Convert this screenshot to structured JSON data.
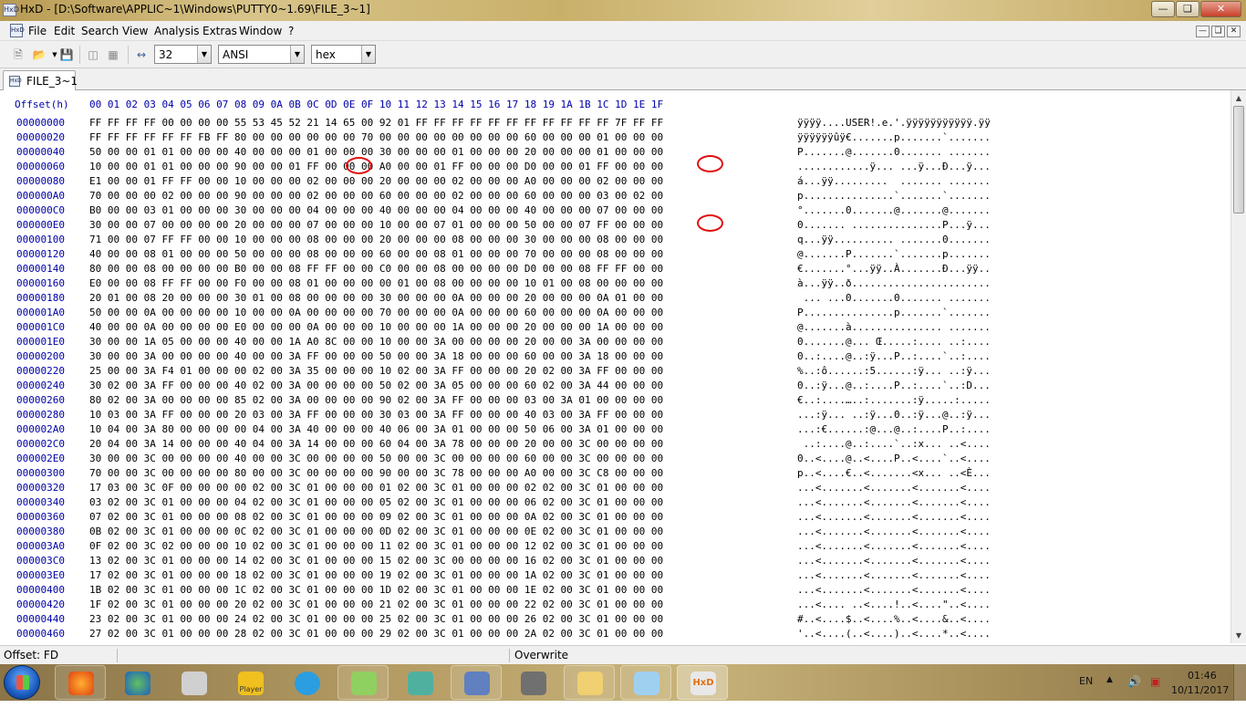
{
  "window": {
    "title": "HxD - [D:\\Software\\APPLIC~1\\Windows\\PUTTY0~1.69\\FILE_3~1]",
    "app_icon_text": "HxD"
  },
  "menu": [
    "File",
    "Edit",
    "Search",
    "View",
    "Analysis",
    "Extras",
    "Window",
    "?"
  ],
  "toolbar": {
    "bytes_per_row": "32",
    "charset": "ANSI",
    "offset_base": "hex"
  },
  "tab": {
    "label": "FILE_3~1"
  },
  "header": {
    "offset_label": "Offset(h)",
    "columns": [
      "00",
      "01",
      "02",
      "03",
      "04",
      "05",
      "06",
      "07",
      "08",
      "09",
      "0A",
      "0B",
      "0C",
      "0D",
      "0E",
      "0F",
      "10",
      "11",
      "12",
      "13",
      "14",
      "15",
      "16",
      "17",
      "18",
      "19",
      "1A",
      "1B",
      "1C",
      "1D",
      "1E",
      "1F"
    ]
  },
  "rows": [
    {
      "offset": "00000000",
      "hex": "FF FF FF FF 00 00 00 00 55 53 45 52 21 14 65 00 92 01 FF FF FF FF FF FF FF FF FF FF FF 7F FF FF",
      "ascii": "ÿÿÿÿ....USER!.e.'.ÿÿÿÿÿÿÿÿÿÿÿ.ÿÿ"
    },
    {
      "offset": "00000020",
      "hex": "FF FF FF FF FF FF FB FF 80 00 00 00 00 00 00 70 00 00 00 00 00 00 00 00 60 00 00 00 01 00 00 00",
      "ascii": "ÿÿÿÿÿÿûÿ€.......p.......`......."
    },
    {
      "offset": "00000040",
      "hex": "50 00 00 01 01 00 00 00 40 00 00 00 01 00 00 00 30 00 00 00 01 00 00 00 20 00 00 00 01 00 00 00",
      "ascii": "P.......@.......0....... ......."
    },
    {
      "offset": "00000060",
      "hex": "10 00 00 01 01 00 00 00 90 00 00 01 FF 00 00 00 A0 00 00 01 FF 00 00 00 D0 00 00 01 FF 00 00 00",
      "ascii": "............ÿ... ...ÿ...Ð...ÿ..."
    },
    {
      "offset": "00000080",
      "hex": "E1 00 00 01 FF FF 00 00 10 00 00 00 02 00 00 00 20 00 00 00 02 00 00 00 A0 00 00 00 02 00 00 00",
      "ascii": "á...ÿÿ.........  ....... ......."
    },
    {
      "offset": "000000A0",
      "hex": "70 00 00 00 02 00 00 00 90 00 00 00 02 00 00 00 60 00 00 00 02 00 00 00 60 00 00 00 03 00 02 00",
      "ascii": "p...............`.......`......."
    },
    {
      "offset": "000000C0",
      "hex": "B0 00 00 03 01 00 00 00 30 00 00 00 04 00 00 00 40 00 00 00 04 00 00 00 40 00 00 00 07 00 00 00",
      "ascii": "°.......0.......@.......@......."
    },
    {
      "offset": "000000E0",
      "hex": "30 00 00 07 00 00 00 00 20 00 00 00 07 00 00 00 10 00 00 07 01 00 00 00 50 00 00 07 FF 00 00 00",
      "ascii": "0....... ...............P...ÿ..."
    },
    {
      "offset": "00000100",
      "hex": "71 00 00 07 FF FF 00 00 10 00 00 00 08 00 00 00 20 00 00 00 08 00 00 00 30 00 00 00 08 00 00 00",
      "ascii": "q...ÿÿ.......... .......0......."
    },
    {
      "offset": "00000120",
      "hex": "40 00 00 08 01 00 00 00 50 00 00 00 08 00 00 00 60 00 00 08 01 00 00 00 70 00 00 00 08 00 00 00",
      "ascii": "@.......P.......`.......p......."
    },
    {
      "offset": "00000140",
      "hex": "80 00 00 08 00 00 00 00 B0 00 00 08 FF FF 00 00 C0 00 00 08 00 00 00 00 D0 00 00 08 FF FF 00 00",
      "ascii": "€.......°...ÿÿ..À.......Ð...ÿÿ.."
    },
    {
      "offset": "00000160",
      "hex": "E0 00 00 08 FF FF 00 00 F0 00 00 08 01 00 00 00 00 01 00 08 00 00 00 00 10 01 00 08 00 00 00 00",
      "ascii": "à...ÿÿ..ð......................."
    },
    {
      "offset": "00000180",
      "hex": "20 01 00 08 20 00 00 00 30 01 00 08 00 00 00 00 30 00 00 00 0A 00 00 00 20 00 00 00 0A 01 00 00",
      "ascii": " ... ...0.......0....... ......."
    },
    {
      "offset": "000001A0",
      "hex": "50 00 00 0A 00 00 00 00 10 00 00 0A 00 00 00 00 70 00 00 00 0A 00 00 00 60 00 00 00 0A 00 00 00",
      "ascii": "P...............p.......`......."
    },
    {
      "offset": "000001C0",
      "hex": "40 00 00 0A 00 00 00 00 E0 00 00 00 0A 00 00 00 10 00 00 00 1A 00 00 00 20 00 00 00 1A 00 00 00",
      "ascii": "@.......à............... ......."
    },
    {
      "offset": "000001E0",
      "hex": "30 00 00 1A 05 00 00 00 40 00 00 1A A0 8C 00 00 10 00 00 3A 00 00 00 00 20 00 00 3A 00 00 00 00",
      "ascii": "0.......@... Œ.....:.... ..:...."
    },
    {
      "offset": "00000200",
      "hex": "30 00 00 3A 00 00 00 00 40 00 00 3A FF 00 00 00 50 00 00 3A 18 00 00 00 60 00 00 3A 18 00 00 00",
      "ascii": "0..:....@..:ÿ...P..:....`..:...."
    },
    {
      "offset": "00000220",
      "hex": "25 00 00 3A F4 01 00 00 00 02 00 3A 35 00 00 00 10 02 00 3A FF 00 00 00 20 02 00 3A FF 00 00 00",
      "ascii": "%..:ô......:5......:ÿ... ..:ÿ..."
    },
    {
      "offset": "00000240",
      "hex": "30 02 00 3A FF 00 00 00 40 02 00 3A 00 00 00 00 50 02 00 3A 05 00 00 00 60 02 00 3A 44 00 00 00",
      "ascii": "0..:ÿ...@..:....P..:....`..:D..."
    },
    {
      "offset": "00000260",
      "hex": "80 02 00 3A 00 00 00 00 85 02 00 3A 00 00 00 00 90 02 00 3A FF 00 00 00 03 00 3A 01 00 00 00 00",
      "ascii": "€..:....…..:.......:ÿ.....:....."
    },
    {
      "offset": "00000280",
      "hex": "10 03 00 3A FF 00 00 00 20 03 00 3A FF 00 00 00 30 03 00 3A FF 00 00 00 40 03 00 3A FF 00 00 00",
      "ascii": "...:ÿ... ..:ÿ...0..:ÿ...@..:ÿ..."
    },
    {
      "offset": "000002A0",
      "hex": "10 04 00 3A 80 00 00 00 00 04 00 3A 40 00 00 00 40 06 00 3A 01 00 00 00 50 06 00 3A 01 00 00 00",
      "ascii": "...:€......:@...@..:....P..:...."
    },
    {
      "offset": "000002C0",
      "hex": "20 04 00 3A 14 00 00 00 40 04 00 3A 14 00 00 00 60 04 00 3A 78 00 00 00 20 00 00 3C 00 00 00 00",
      "ascii": " ..:....@..:....`..:x... ..<...."
    },
    {
      "offset": "000002E0",
      "hex": "30 00 00 3C 00 00 00 00 40 00 00 3C 00 00 00 00 50 00 00 3C 00 00 00 00 60 00 00 3C 00 00 00 00",
      "ascii": "0..<....@..<....P..<....`..<...."
    },
    {
      "offset": "00000300",
      "hex": "70 00 00 3C 00 00 00 00 80 00 00 3C 00 00 00 00 90 00 00 3C 78 00 00 00 A0 00 00 3C C8 00 00 00",
      "ascii": "p..<....€..<.......<x... ..<È..."
    },
    {
      "offset": "00000320",
      "hex": "17 03 00 3C 0F 00 00 00 00 02 00 3C 01 00 00 00 01 02 00 3C 01 00 00 00 02 02 00 3C 01 00 00 00",
      "ascii": "...<.......<.......<.......<...."
    },
    {
      "offset": "00000340",
      "hex": "03 02 00 3C 01 00 00 00 04 02 00 3C 01 00 00 00 05 02 00 3C 01 00 00 00 06 02 00 3C 01 00 00 00",
      "ascii": "...<.......<.......<.......<...."
    },
    {
      "offset": "00000360",
      "hex": "07 02 00 3C 01 00 00 00 08 02 00 3C 01 00 00 00 09 02 00 3C 01 00 00 00 0A 02 00 3C 01 00 00 00",
      "ascii": "...<.......<.......<.......<...."
    },
    {
      "offset": "00000380",
      "hex": "0B 02 00 3C 01 00 00 00 0C 02 00 3C 01 00 00 00 0D 02 00 3C 01 00 00 00 0E 02 00 3C 01 00 00 00",
      "ascii": "...<.......<.......<.......<...."
    },
    {
      "offset": "000003A0",
      "hex": "0F 02 00 3C 02 00 00 00 10 02 00 3C 01 00 00 00 11 02 00 3C 01 00 00 00 12 02 00 3C 01 00 00 00",
      "ascii": "...<.......<.......<.......<...."
    },
    {
      "offset": "000003C0",
      "hex": "13 02 00 3C 01 00 00 00 14 02 00 3C 01 00 00 00 15 02 00 3C 00 00 00 00 16 02 00 3C 01 00 00 00",
      "ascii": "...<.......<.......<.......<...."
    },
    {
      "offset": "000003E0",
      "hex": "17 02 00 3C 01 00 00 00 18 02 00 3C 01 00 00 00 19 02 00 3C 01 00 00 00 1A 02 00 3C 01 00 00 00",
      "ascii": "...<.......<.......<.......<...."
    },
    {
      "offset": "00000400",
      "hex": "1B 02 00 3C 01 00 00 00 1C 02 00 3C 01 00 00 00 1D 02 00 3C 01 00 00 00 1E 02 00 3C 01 00 00 00",
      "ascii": "...<.......<.......<.......<...."
    },
    {
      "offset": "00000420",
      "hex": "1F 02 00 3C 01 00 00 00 20 02 00 3C 01 00 00 00 21 02 00 3C 01 00 00 00 22 02 00 3C 01 00 00 00",
      "ascii": "...<.... ..<....!..<....\"..<...."
    },
    {
      "offset": "00000440",
      "hex": "23 02 00 3C 01 00 00 00 24 02 00 3C 01 00 00 00 25 02 00 3C 01 00 00 00 26 02 00 3C 01 00 00 00",
      "ascii": "#..<....$..<....%..<....&..<...."
    },
    {
      "offset": "00000460",
      "hex": "27 02 00 3C 01 00 00 00 28 02 00 3C 01 00 00 00 29 02 00 3C 01 00 00 00 2A 02 00 3C 01 00 00 00",
      "ascii": "'..<....(..<....)..<....*..<...."
    }
  ],
  "status": {
    "offset": "Offset: FD",
    "mode": "Overwrite"
  },
  "tray": {
    "language": "EN",
    "time": "01:46",
    "date": "10/11/2017"
  },
  "taskbar_items": [
    "firefox-icon",
    "idm-icon",
    "network-tool-icon",
    "player-icon",
    "telegram-icon",
    "notepad-plus-icon",
    "cube-app-icon",
    "network-monitor-icon",
    "disk-tool-icon",
    "file-explorer-icon",
    "notepad-icon",
    "hxd-icon"
  ],
  "taskbar_player_label": "Player",
  "colors": {
    "offset": "#0000a8",
    "mark": "#e01010"
  }
}
